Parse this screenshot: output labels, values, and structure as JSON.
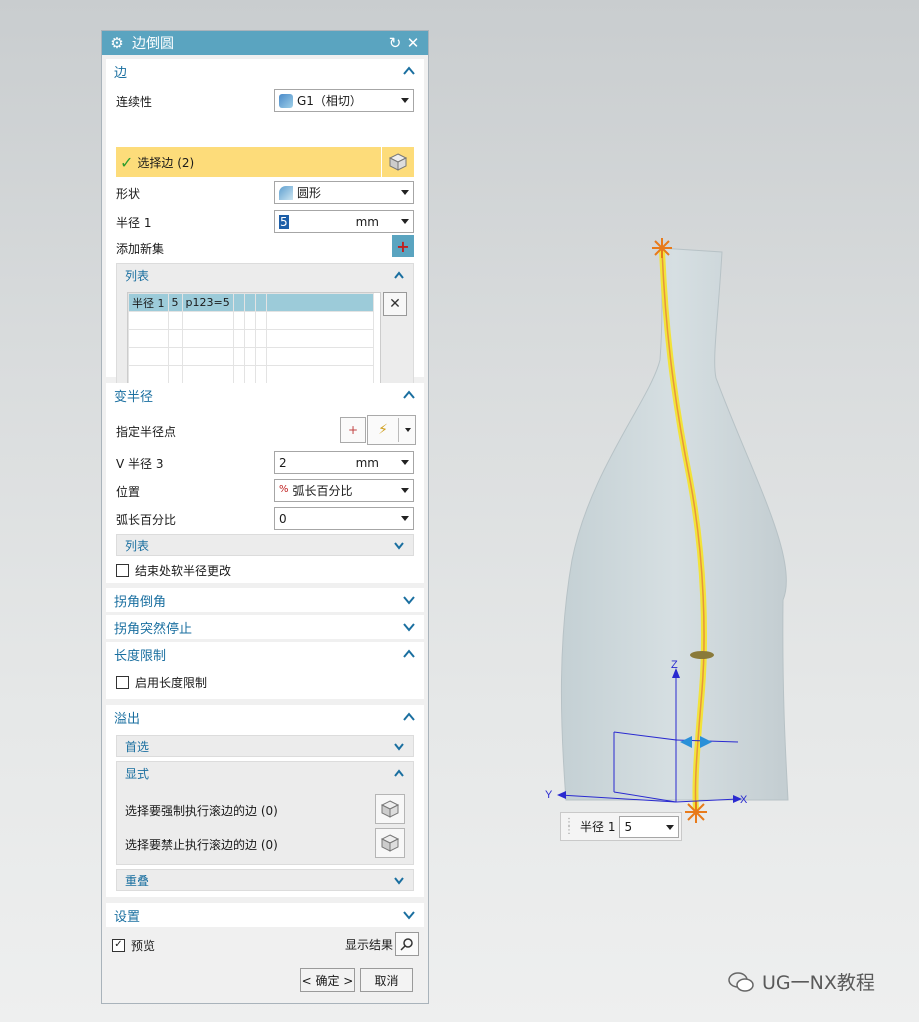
{
  "dialog": {
    "title": "边倒圆",
    "edge": {
      "header": "边",
      "continuity_label": "连续性",
      "continuity_value": "G1（相切）",
      "select_edge": "选择边 (2)",
      "shape_label": "形状",
      "shape_value": "圆形",
      "radius_label": "半径 1",
      "radius_value": "5",
      "radius_unit": "mm",
      "add_new_set": "添加新集",
      "list_header": "列表",
      "list_row": [
        "半径 1",
        "5",
        "p123=5"
      ]
    },
    "variable_radius": {
      "header": "变半径",
      "specify_point": "指定半径点",
      "v_radius_label": "V 半径 3",
      "v_radius_value": "2",
      "v_radius_unit": "mm",
      "position_label": "位置",
      "position_value": "弧长百分比",
      "arc_pct_label": "弧长百分比",
      "arc_pct_value": "0",
      "list_header": "列表",
      "soften_end": "结束处软半径更改"
    },
    "corner_setback": "拐角倒角",
    "corner_abrupt": "拐角突然停止",
    "length_limit": {
      "header": "长度限制",
      "enable": "启用长度限制"
    },
    "overflow": {
      "header": "溢出",
      "preferred": "首选",
      "explicit": "显式",
      "force_roll": "选择要强制执行滚边的边 (0)",
      "forbid_roll": "选择要禁止执行滚边的边 (0)",
      "overlap": "重叠"
    },
    "settings": "设置",
    "preview": "预览",
    "show_result": "显示结果",
    "ok": "< 确定 >",
    "cancel": "取消"
  },
  "viewport": {
    "axis_x": "X",
    "axis_y": "Y",
    "axis_z": "Z",
    "radius_popup_label": "半径 1",
    "radius_popup_value": "5"
  },
  "watermark": "UG一NX教程",
  "colors": {
    "title_bar": "#5aa4c0",
    "section_header_text": "#1a6fa0",
    "selection_highlight": "#fddc7a",
    "list_row_selected": "#9ccbd9",
    "edge_highlight": "#f2e33a",
    "axis_blue": "#2a2ad0"
  }
}
